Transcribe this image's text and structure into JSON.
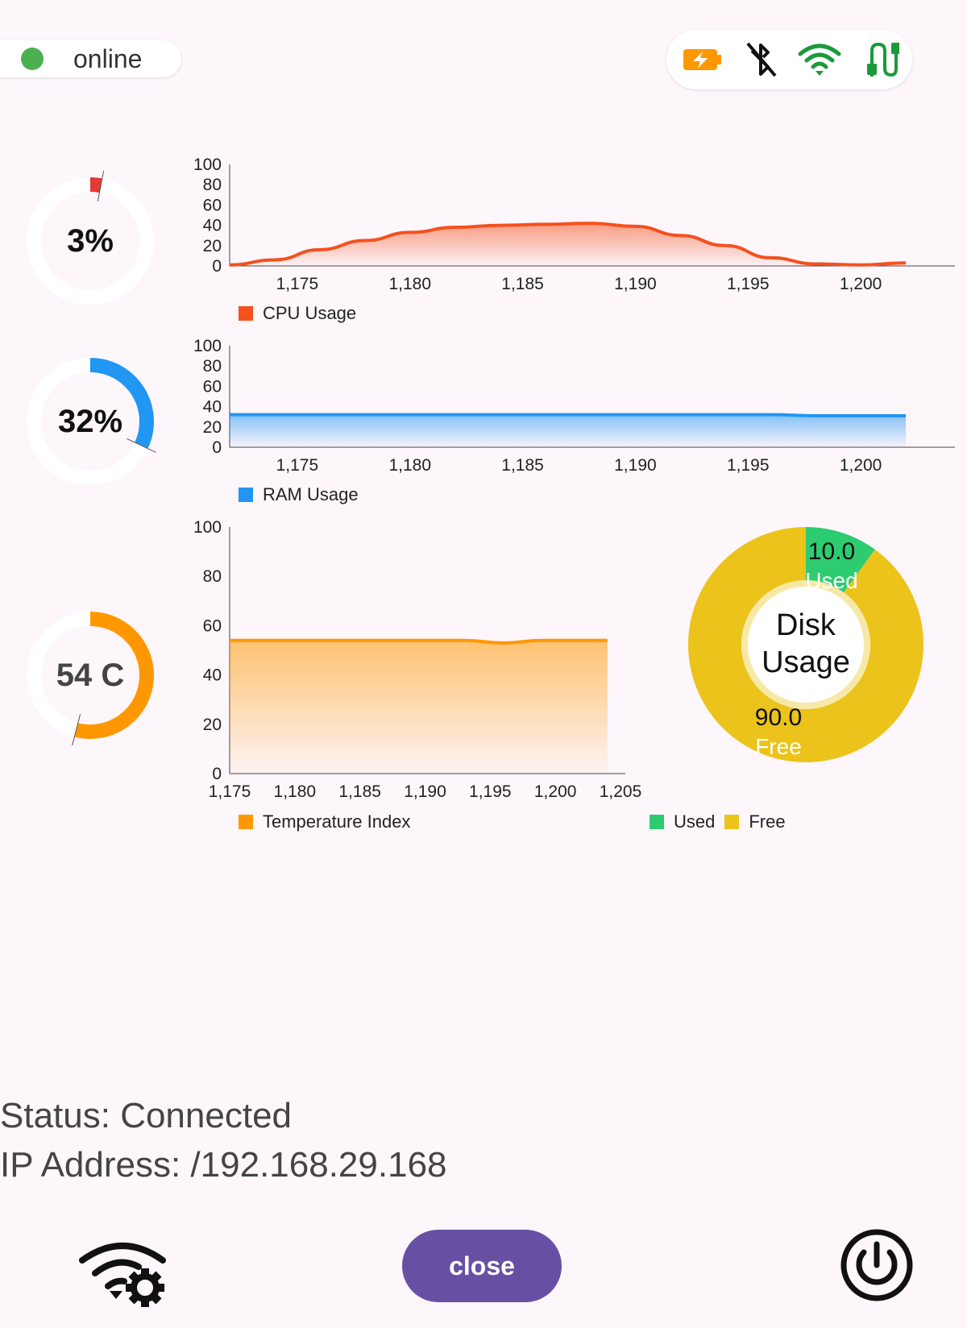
{
  "connection_status": {
    "label": "online",
    "color": "#4caf50"
  },
  "status_icons": [
    "battery-charging-icon",
    "bluetooth-disabled-icon",
    "wifi-icon",
    "cable-icon"
  ],
  "gauges": [
    {
      "name": "cpu",
      "text": "3%",
      "value": 3,
      "max": 100,
      "color": "#e53935"
    },
    {
      "name": "ram",
      "text": "32%",
      "value": 32,
      "max": 100,
      "color": "#2196f3"
    },
    {
      "name": "temp",
      "text": "54 C",
      "value": 54,
      "max": 100,
      "color": "#ff9800"
    }
  ],
  "chart_data": [
    {
      "type": "area",
      "x": [
        1172,
        1174,
        1176,
        1178,
        1180,
        1182,
        1184,
        1186,
        1188,
        1190,
        1192,
        1194,
        1196,
        1198,
        1200,
        1202
      ],
      "series": [
        {
          "name": "CPU Usage",
          "color": "#f4511e",
          "values": [
            1,
            6,
            16,
            25,
            33,
            38,
            40,
            41,
            42,
            39,
            30,
            20,
            8,
            2,
            1,
            3
          ]
        }
      ],
      "ylim": [
        0,
        100
      ],
      "yticks": [
        0,
        20,
        40,
        60,
        80,
        100
      ],
      "xticks": [
        "1,175",
        "1,180",
        "1,185",
        "1,190",
        "1,195",
        "1,200"
      ],
      "xtick_values": [
        1175,
        1180,
        1185,
        1190,
        1195,
        1200
      ],
      "xlim": [
        1172,
        1203
      ]
    },
    {
      "type": "area",
      "x": [
        1172,
        1176,
        1180,
        1184,
        1188,
        1192,
        1196,
        1198,
        1200,
        1202
      ],
      "series": [
        {
          "name": "RAM Usage",
          "color": "#2196f3",
          "values": [
            32,
            32,
            32,
            32,
            32,
            32,
            32,
            31,
            31,
            31
          ]
        }
      ],
      "ylim": [
        0,
        100
      ],
      "yticks": [
        0,
        20,
        40,
        60,
        80,
        100
      ],
      "xticks": [
        "1,175",
        "1,180",
        "1,185",
        "1,190",
        "1,195",
        "1,200"
      ],
      "xtick_values": [
        1175,
        1180,
        1185,
        1190,
        1195,
        1200
      ],
      "xlim": [
        1172,
        1203
      ]
    },
    {
      "type": "area",
      "x": [
        1175,
        1180,
        1185,
        1190,
        1193,
        1196,
        1199,
        1204
      ],
      "series": [
        {
          "name": "Temperature Index",
          "color": "#ff9800",
          "values": [
            54,
            54,
            54,
            54,
            54,
            53,
            54,
            54
          ]
        }
      ],
      "ylim": [
        0,
        100
      ],
      "yticks": [
        0,
        20,
        40,
        60,
        80,
        100
      ],
      "xticks": [
        "1,175",
        "1,180",
        "1,185",
        "1,190",
        "1,195",
        "1,200",
        "1,205"
      ],
      "xtick_values": [
        1175,
        1180,
        1185,
        1190,
        1195,
        1200,
        1205
      ],
      "xlim": [
        1175,
        1205
      ]
    },
    {
      "type": "pie",
      "title": "Disk Usage",
      "categories": [
        "Used",
        "Free"
      ],
      "values": [
        10.0,
        90.0
      ],
      "value_labels": [
        "10.0",
        "90.0"
      ],
      "colors": [
        "#2ecc71",
        "#ecc31a"
      ]
    }
  ],
  "info": {
    "status": "Status: Connected",
    "ip": "IP Address: /192.168.29.168"
  },
  "buttons": {
    "close": "close"
  }
}
